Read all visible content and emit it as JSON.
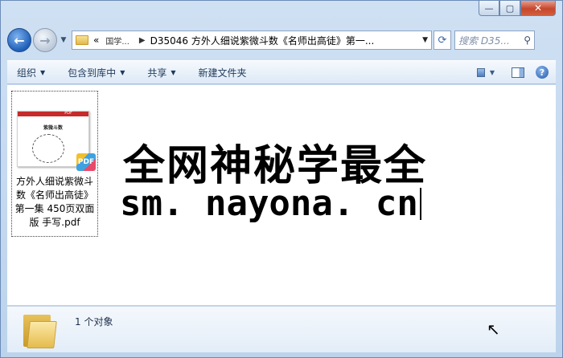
{
  "window": {
    "minimize": "—",
    "maximize": "▢",
    "close": "✕"
  },
  "nav": {
    "back": "←",
    "forward": "→",
    "history_drop": "▼",
    "address": {
      "overflow": "«",
      "crumb1": "国学...",
      "crumb2": "D35046 方外人细说紫微斗数《名师出高徒》第一...",
      "sep": "▶",
      "drop": "▼"
    },
    "refresh": "⟳",
    "search_placeholder": "搜索 D35...",
    "search_icon": "⚲"
  },
  "toolbar": {
    "organize": "组织",
    "include_library": "包含到库中",
    "share": "共享",
    "new_folder": "新建文件夹",
    "drop": "▼",
    "help": "?"
  },
  "file": {
    "name": "方外人细说紫微斗数《名师出高徒》第一集 450页双面版 手写.pdf",
    "thumb_header": "PDF",
    "thumb_title": "紫微斗数",
    "badge": "PDF"
  },
  "watermark": {
    "line1": "全网神秘学最全",
    "line2": "sm. nayona. cn"
  },
  "status": {
    "count": "1 个对象"
  }
}
